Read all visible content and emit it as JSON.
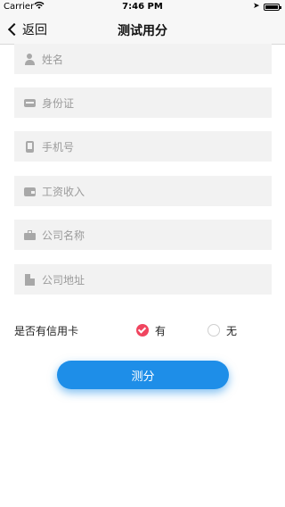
{
  "status_bar": {
    "carrier": "Carrier",
    "wifi_icon": "wifi-icon",
    "time": "7:46 PM",
    "location_icon": "location-arrow-icon",
    "battery_icon": "battery-icon"
  },
  "nav": {
    "back_label": "返回",
    "title": "测试用分"
  },
  "form": {
    "fields": [
      {
        "icon": "person-icon",
        "placeholder": "姓名"
      },
      {
        "icon": "id-card-icon",
        "placeholder": "身份证"
      },
      {
        "icon": "phone-icon",
        "placeholder": "手机号"
      },
      {
        "icon": "wallet-icon",
        "placeholder": "工资收入"
      },
      {
        "icon": "briefcase-icon",
        "placeholder": "公司名称"
      },
      {
        "icon": "building-icon",
        "placeholder": "公司地址"
      }
    ],
    "credit_card": {
      "label": "是否有信用卡",
      "options": [
        {
          "label": "有",
          "selected": true
        },
        {
          "label": "无",
          "selected": false
        }
      ]
    },
    "submit_label": "测分"
  },
  "colors": {
    "accent": "#1e8ee8",
    "radio_selected": "#f0455f",
    "field_bg": "#f2f2f2",
    "placeholder_text": "#9b9b9b"
  }
}
